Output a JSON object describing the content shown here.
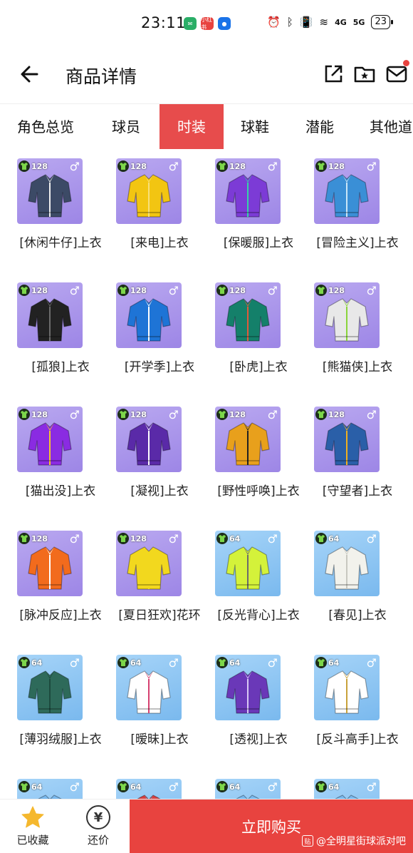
{
  "status_bar": {
    "time": "23:11",
    "apps": [
      {
        "name": "wechat-icon",
        "color": "#2aae67",
        "glyph": "✉"
      },
      {
        "name": "xiaohongshu-icon",
        "color": "#e8433f",
        "glyph": "小红书"
      },
      {
        "name": "chat-app-icon",
        "color": "#1a73e8",
        "glyph": "●"
      }
    ],
    "signal_4g": "4G",
    "signal_5g": "5G",
    "battery": "23"
  },
  "nav": {
    "title": "商品详情"
  },
  "tabs": [
    "角色总览",
    "球员",
    "时装",
    "球鞋",
    "潜能",
    "其他道"
  ],
  "active_tab": "时装",
  "items": [
    {
      "name": "[休闲牛仔]上衣",
      "level": "128",
      "bg": "purple",
      "main": "#3c4a66",
      "accent": "#eeeeee"
    },
    {
      "name": "[来电]上衣",
      "level": "128",
      "bg": "purple",
      "main": "#f2c512",
      "accent": "#f7e07a"
    },
    {
      "name": "[保暖服]上衣",
      "level": "128",
      "bg": "purple",
      "main": "#7c3bd6",
      "accent": "#36d1a8"
    },
    {
      "name": "[冒险主义]上衣",
      "level": "128",
      "bg": "purple",
      "main": "#3a8fd6",
      "accent": "#c9e6f7"
    },
    {
      "name": "[孤狼]上衣",
      "level": "128",
      "bg": "purple",
      "main": "#222222",
      "accent": "#6c6c6c"
    },
    {
      "name": "[开学季]上衣",
      "level": "128",
      "bg": "purple",
      "main": "#1e74d6",
      "accent": "#ffffff"
    },
    {
      "name": "[卧虎]上衣",
      "level": "128",
      "bg": "purple",
      "main": "#14806a",
      "accent": "#e05a3b"
    },
    {
      "name": "[熊猫侠]上衣",
      "level": "128",
      "bg": "purple",
      "main": "#e8e8e8",
      "accent": "#8ad43b"
    },
    {
      "name": "[猫出没]上衣",
      "level": "128",
      "bg": "purple",
      "main": "#8a2be2",
      "accent": "#f4c430"
    },
    {
      "name": "[凝视]上衣",
      "level": "128",
      "bg": "purple",
      "main": "#5a2aa8",
      "accent": "#ffffff"
    },
    {
      "name": "[野性呼唤]上衣",
      "level": "128",
      "bg": "purple",
      "main": "#e8a01c",
      "accent": "#222222"
    },
    {
      "name": "[守望者]上衣",
      "level": "128",
      "bg": "purple",
      "main": "#2a5fa8",
      "accent": "#f2b01e"
    },
    {
      "name": "[脉冲反应]上衣",
      "level": "128",
      "bg": "purple",
      "main": "#f26b1d",
      "accent": "#ffffff"
    },
    {
      "name": "[夏日狂欢]花环",
      "level": "128",
      "bg": "purple",
      "main": "#f2d81e",
      "accent": "#f2d81e"
    },
    {
      "name": "[反光背心]上衣",
      "level": "64",
      "bg": "blue",
      "main": "#d4f23a",
      "accent": "#6c6c6c"
    },
    {
      "name": "[春见]上衣",
      "level": "64",
      "bg": "blue",
      "main": "#f2f2ec",
      "accent": "#c8c8c0"
    },
    {
      "name": "[薄羽绒服]上衣",
      "level": "64",
      "bg": "blue",
      "main": "#2e6a5a",
      "accent": "#1d4a3e"
    },
    {
      "name": "[暧昧]上衣",
      "level": "64",
      "bg": "blue",
      "main": "#ffffff",
      "accent": "#d64070"
    },
    {
      "name": "[透视]上衣",
      "level": "64",
      "bg": "blue",
      "main": "#6a38b8",
      "accent": "#d8c8f4"
    },
    {
      "name": "[反斗高手]上衣",
      "level": "64",
      "bg": "blue",
      "main": "#ffffff",
      "accent": "#c8a23a"
    },
    {
      "name": "",
      "level": "64",
      "bg": "blue",
      "main": "#7ab9ee",
      "accent": "#7ab9ee"
    },
    {
      "name": "",
      "level": "64",
      "bg": "blue",
      "main": "#d84040",
      "accent": "#7ab9ee"
    },
    {
      "name": "",
      "level": "64",
      "bg": "blue",
      "main": "#7ab9ee",
      "accent": "#7ab9ee"
    },
    {
      "name": "",
      "level": "64",
      "bg": "blue",
      "main": "#7ab9ee",
      "accent": "#7ab9ee"
    }
  ],
  "gender_symbol": "♂",
  "bottom_bar": {
    "favorite_label": "已收藏",
    "bargain_label": "还价",
    "bargain_glyph": "¥",
    "buy_label": "立即购买",
    "watermark": "@全明星街球派对吧"
  },
  "colors": {
    "brand_red": "#e8433f",
    "tab_active_bg": "#e74c4c",
    "star_yellow": "#f5b82e"
  }
}
